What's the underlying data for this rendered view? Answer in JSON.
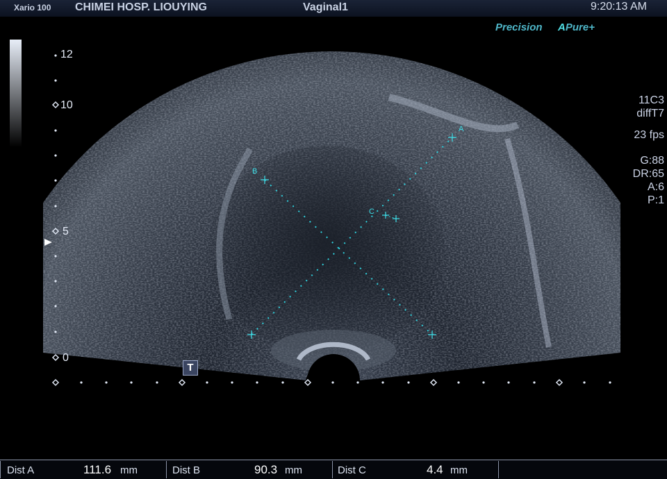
{
  "header": {
    "model": "Xario 100",
    "hospital": "CHIMEI HOSP. LIOUYING",
    "preset": "Vaginal1",
    "time": "9:20:13 AM"
  },
  "brand": {
    "precision": "Precision",
    "apure_a": "A",
    "apure": "Pure+"
  },
  "params": {
    "probe": "11C3",
    "mode": "diffT7",
    "fps": "23 fps",
    "gain": "G:88",
    "dr": "DR:65",
    "a": "A:6",
    "p": "P:1"
  },
  "depth_scale": {
    "top": "12",
    "mid_high": "10",
    "mid": "5",
    "zero": "0"
  },
  "markers": {
    "a": "A",
    "b": "B",
    "c": "C",
    "t": "T"
  },
  "measurements": [
    {
      "label": "Dist  A",
      "value": "111.6",
      "unit": "mm"
    },
    {
      "label": "Dist  B",
      "value": "90.3",
      "unit": "mm"
    },
    {
      "label": "Dist  C",
      "value": "4.4",
      "unit": "mm"
    }
  ]
}
